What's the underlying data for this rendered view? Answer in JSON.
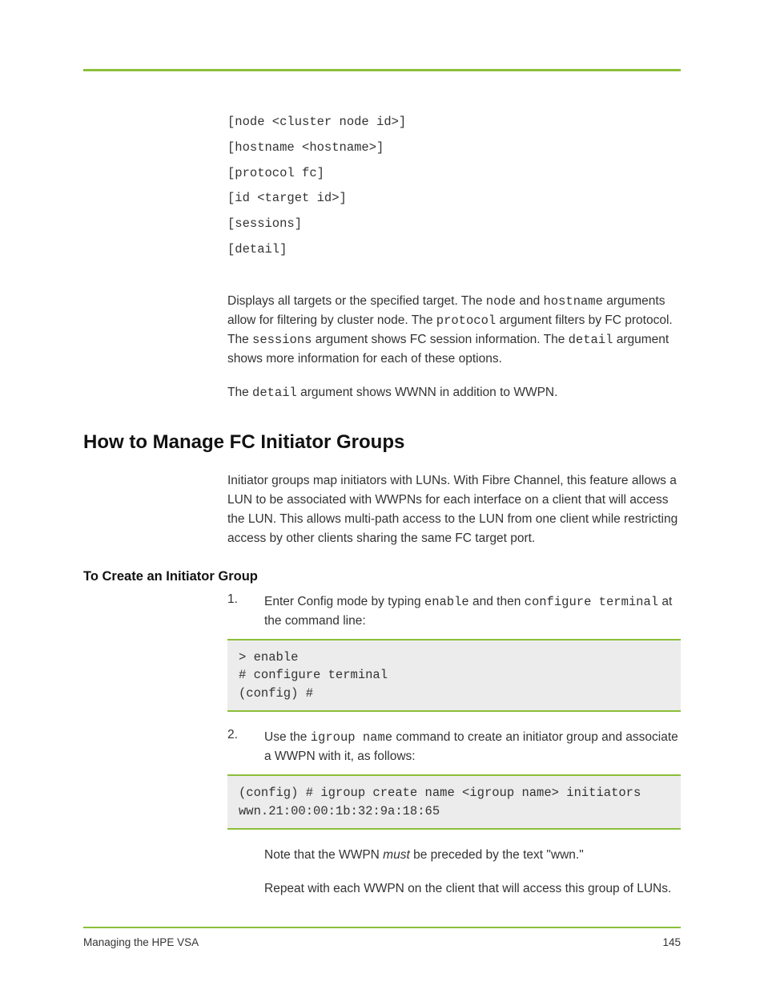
{
  "syntax": {
    "lines": [
      "[node <cluster node id>]",
      "[hostname <hostname>]",
      "[protocol fc]",
      "[id <target id>]",
      "[sessions]",
      "[detail]"
    ]
  },
  "body": {
    "p1_prefix": "Displays all targets or the specified target. The ",
    "p1_code1": "node",
    "p1_mid1": " and ",
    "p1_code2": "hostname",
    "p1_mid2": " arguments allow for filtering by cluster node. The ",
    "p1_code3": "protocol",
    "p1_mid3": " argument filters by FC protocol. The ",
    "p1_code4": "sessions",
    "p1_mid4": " argument shows FC session information. The ",
    "p1_code5": "detail",
    "p1_tail": " argument shows more information for each of these options.",
    "p2_prefix": "The ",
    "p2_code": "detail",
    "p2_tail": " argument shows WWNN in addition to WWPN."
  },
  "h1": "How to Manage FC Initiator Groups",
  "intro": "Initiator groups map initiators with LUNs. With Fibre Channel, this feature allows a LUN to be associated with WWPNs for each interface on a client that will access the LUN. This allows multi-path access to the LUN from one client while restricting access by other clients sharing the same FC target port.",
  "h2": "To Create an Initiator Group",
  "steps": {
    "step1": {
      "num": "1.",
      "text_1": "Enter Config mode by typing ",
      "code1": "enable",
      "text_2": " and then ",
      "code2": "configure terminal",
      "text_3": " at the command line:"
    },
    "step2": {
      "num": "2.",
      "text_1": "Use the ",
      "code1": "igroup name",
      "text_2": " command to create an initiator group and associate a WWPN with it, as follows:"
    }
  },
  "codebox1": "> enable\n# configure terminal\n(config) #",
  "codebox2": "(config) # igroup create name <igroup name> initiators wwn.21:00:00:1b:32:9a:18:65",
  "note": {
    "p1_pre": "Note that the WWPN ",
    "p1_ital": "must",
    "p1_post": " be preceded by the text \"wwn.\"",
    "p2": "Repeat with each WWPN on the client that will access this group of LUNs."
  },
  "footer": {
    "left": "Managing the HPE VSA",
    "right": "145"
  }
}
